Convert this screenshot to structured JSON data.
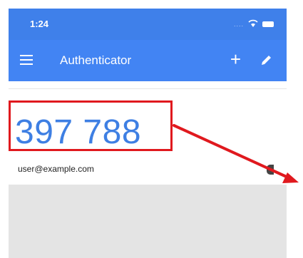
{
  "status_bar": {
    "time": "1:24",
    "signal": "....",
    "wifi": "wifi-icon",
    "battery": "battery-icon"
  },
  "app_bar": {
    "title": "Authenticator",
    "menu_icon": "menu-icon",
    "add_label": "+",
    "edit_icon": "pencil-icon"
  },
  "entry": {
    "code": "397 788",
    "account": "user@example.com",
    "timer_icon": "timer-icon"
  },
  "colors": {
    "status_bar": "#3f80ea",
    "app_bar": "#4284f3",
    "code": "#3e7fe3",
    "highlight": "#e0191e",
    "footer": "#e4e4e4"
  }
}
